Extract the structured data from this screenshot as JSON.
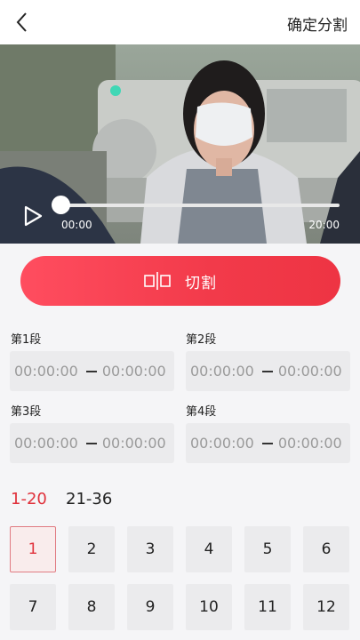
{
  "header": {
    "confirm_label": "确定分割"
  },
  "player": {
    "current_time": "00:00",
    "total_time": "20:00",
    "progress": 0
  },
  "cut_button": {
    "label": "切割"
  },
  "segments": [
    {
      "label": "第1段",
      "start": "00:00:00",
      "end": "00:00:00"
    },
    {
      "label": "第2段",
      "start": "00:00:00",
      "end": "00:00:00"
    },
    {
      "label": "第3段",
      "start": "00:00:00",
      "end": "00:00:00"
    },
    {
      "label": "第4段",
      "start": "00:00:00",
      "end": "00:00:00"
    }
  ],
  "range_tabs": [
    {
      "label": "1-20",
      "active": true
    },
    {
      "label": "21-36",
      "active": false
    }
  ],
  "numbers": [
    "1",
    "2",
    "3",
    "4",
    "5",
    "6",
    "7",
    "8",
    "9",
    "10",
    "11",
    "12"
  ],
  "selected_number": "1",
  "colors": {
    "accent": "#e0323c",
    "button_start": "#ff4d5f",
    "button_end": "#ee3443"
  }
}
